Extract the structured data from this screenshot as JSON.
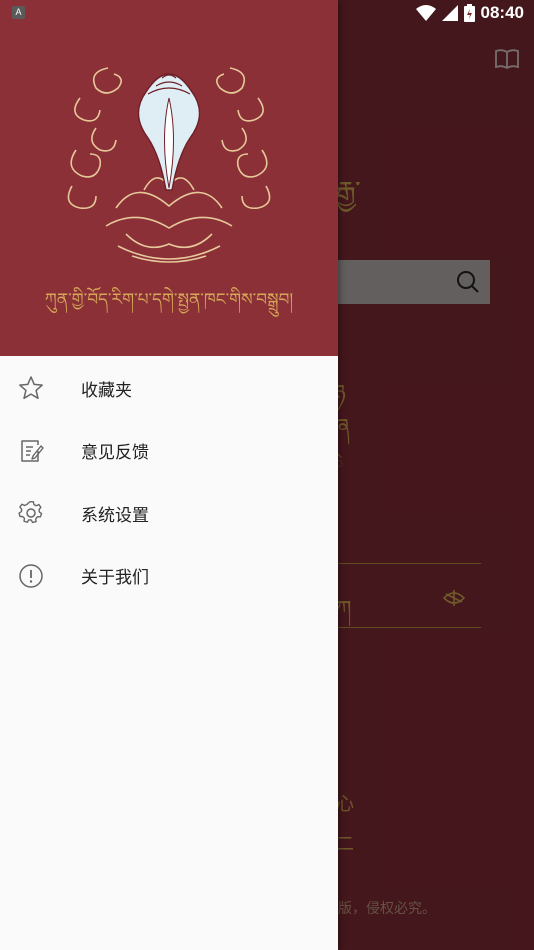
{
  "status_bar": {
    "time": "08:40",
    "app_badge": "A",
    "icons": [
      "wifi-icon",
      "cell-signal-icon",
      "battery-icon"
    ]
  },
  "drawer": {
    "header": {
      "emblem": "conch-shell-lotus-emblem",
      "motto": "ཀུན་གྱི་བོད་རིག་པ་དགེ་སྤྱན་ཁང་གིས་བསྒྲུབ།"
    },
    "menu": [
      {
        "label": "收藏夹",
        "icon": "star-icon"
      },
      {
        "label": "意见反馈",
        "icon": "feedback-edit-icon"
      },
      {
        "label": "系统设置",
        "icon": "gear-icon"
      },
      {
        "label": "关于我们",
        "icon": "info-exclamation-icon"
      }
    ]
  },
  "background_app": {
    "title_fragment": "རྒྱ་",
    "footer_fragment": "版，侵权必究。",
    "icons": [
      "book-icon",
      "search-icon",
      "lotus-flower-icon"
    ]
  },
  "colors": {
    "drawer_header": "#8c3038",
    "gold_accent": "#d4a657",
    "drawer_bg": "#fafafa",
    "app_bg": "#7d2a33"
  }
}
